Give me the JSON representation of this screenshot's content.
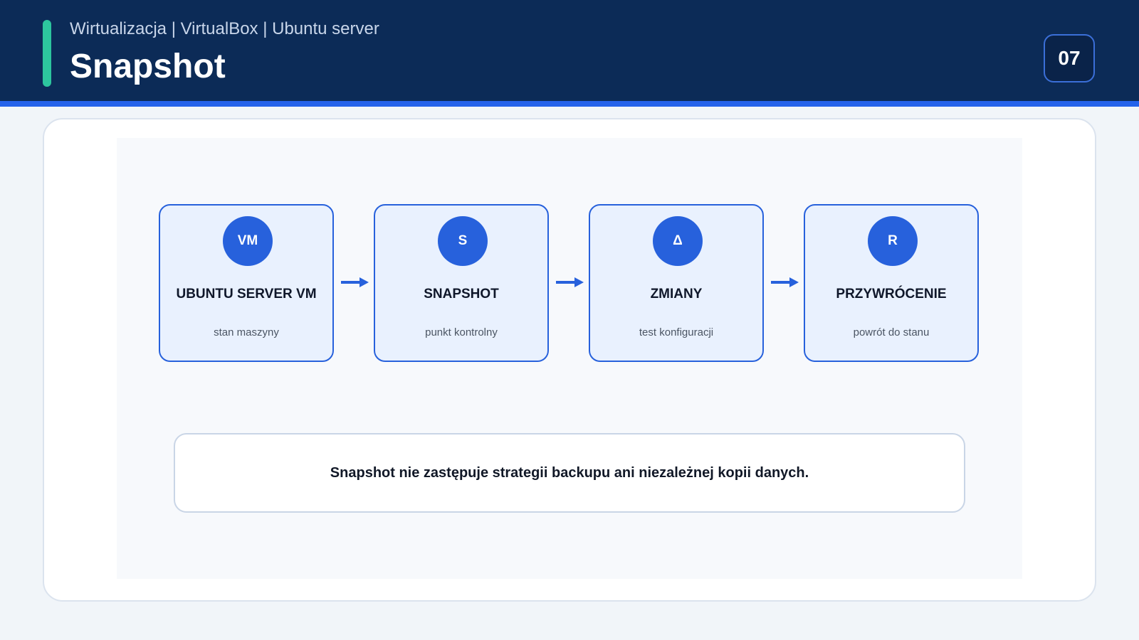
{
  "header": {
    "breadcrumb": "Wirtualizacja | VirtualBox | Ubuntu server",
    "title": "Snapshot",
    "page_number": "07"
  },
  "diagram": {
    "steps": [
      {
        "badge": "VM",
        "title": "UBUNTU SERVER VM",
        "description": "stan maszyny"
      },
      {
        "badge": "S",
        "title": "SNAPSHOT",
        "description": "punkt kontrolny"
      },
      {
        "badge": "Δ",
        "title": "ZMIANY",
        "description": "test konfiguracji"
      },
      {
        "badge": "R",
        "title": "PRZYWRÓCENIE",
        "description": "powrót do stanu"
      }
    ],
    "arrow_icon": "arrow-right-icon"
  },
  "note": {
    "text": "Snapshot nie zastępuje strategii backupu ani niezależnej kopii danych."
  },
  "colors": {
    "header_bg": "#0c2b57",
    "accent_blue": "#2761dc",
    "accent_green": "#2dc69e"
  }
}
